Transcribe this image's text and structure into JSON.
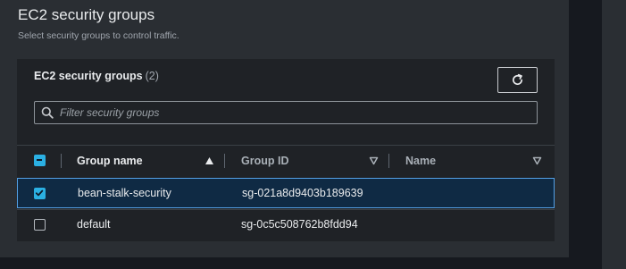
{
  "section": {
    "title": "EC2 security groups",
    "description": "Select security groups to control traffic."
  },
  "card": {
    "title": "EC2 security groups",
    "count": "(2)"
  },
  "filter": {
    "placeholder": "Filter security groups",
    "value": ""
  },
  "table": {
    "columns": [
      "Group name",
      "Group ID",
      "Name"
    ],
    "sort": {
      "column": "Group name",
      "direction": "ascending"
    },
    "rows": [
      {
        "group_name": "bean-stalk-security",
        "group_id": "sg-021a8d9403b189639",
        "name": "",
        "selected": true
      },
      {
        "group_name": "default",
        "group_id": "sg-0c5c508762b8fdd94",
        "name": "",
        "selected": false
      }
    ]
  },
  "colors": {
    "accent": "#2bb0e3",
    "selected_row_bg": "#0f2a44",
    "selected_row_border": "#539fe5"
  }
}
